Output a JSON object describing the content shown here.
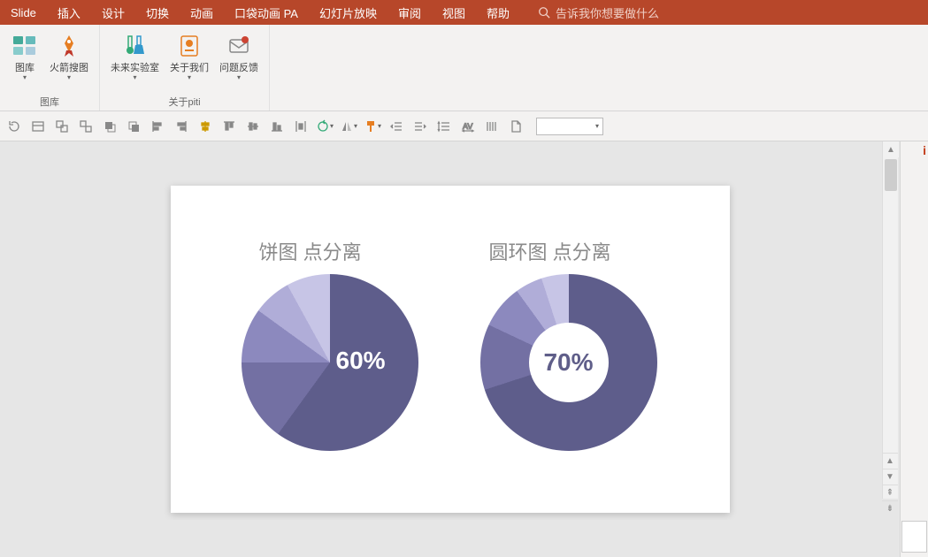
{
  "tabs": {
    "t0": "Slide",
    "t1": "插入",
    "t2": "设计",
    "t3": "切换",
    "t4": "动画",
    "t5": "口袋动画 PA",
    "t6": "幻灯片放映",
    "t7": "审阅",
    "t8": "视图",
    "t9": "帮助"
  },
  "search": {
    "placeholder": "告诉我你想要做什么"
  },
  "ribbon": {
    "group1": {
      "label": "图库",
      "b1": "图库",
      "b2": "火箭搜图"
    },
    "group2": {
      "label": "关于piti",
      "b1": "未来实验室",
      "b2": "关于我们",
      "b3": "问题反馈"
    }
  },
  "slide": {
    "chart1": {
      "title": "饼图 点分离",
      "label": "60%"
    },
    "chart2": {
      "title": "圆环图 点分离",
      "label": "70%"
    }
  },
  "chart_data": [
    {
      "type": "pie",
      "title": "饼图 点分离",
      "values": [
        60,
        15,
        10,
        7,
        8
      ],
      "center_label": "60%",
      "colors": [
        "#5e5d8b",
        "#7370a3",
        "#8c89be",
        "#b0add8",
        "#c7c5e6"
      ]
    },
    {
      "type": "pie",
      "subtype": "donut",
      "title": "圆环图 点分离",
      "values": [
        70,
        12,
        8,
        5,
        5
      ],
      "center_label": "70%",
      "colors": [
        "#5e5d8b",
        "#7370a3",
        "#8c89be",
        "#b0add8",
        "#c7c5e6"
      ]
    }
  ],
  "panel_marker": "i"
}
